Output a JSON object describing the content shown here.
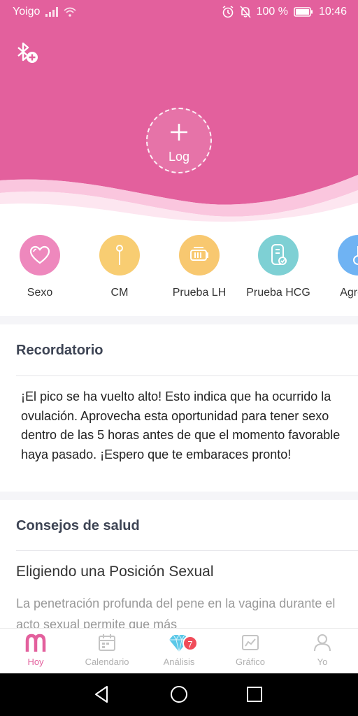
{
  "status_bar": {
    "carrier": "Yoigo",
    "battery": "100 %",
    "time": "10:46"
  },
  "header": {
    "log_label": "Log",
    "colors": {
      "primary": "#e3609d",
      "light": "#f9bcd8"
    }
  },
  "quick_actions": [
    {
      "label": "Sexo",
      "icon": "heart-icon",
      "color": "#ee88bd"
    },
    {
      "label": "CM",
      "icon": "cm-drop-icon",
      "color": "#f8cd72"
    },
    {
      "label": "Prueba LH",
      "icon": "lh-test-icon",
      "color": "#f8c870"
    },
    {
      "label": "Prueba HCG",
      "icon": "hcg-test-icon",
      "color": "#7ed0d4"
    },
    {
      "label": "Agrega",
      "icon": "add-record-icon",
      "color": "#6fb3f3"
    }
  ],
  "reminder": {
    "title": "Recordatorio",
    "text": "¡El pico se ha vuelto alto! Esto indica que ha ocurrido la ovulación. Aprovecha esta oportunidad para tener sexo dentro de las 5 horas antes de que el momento favorable haya pasado. ¡Espero que te embaraces pronto!"
  },
  "health_tips": {
    "title": "Consejos de salud",
    "article_title": "Eligiendo una Posición Sexual",
    "article_excerpt": "La penetración profunda del pene en la vagina durante el acto sexual permite que más"
  },
  "tabs": [
    {
      "label": "Hoy",
      "icon": "today-icon",
      "active": true
    },
    {
      "label": "Calendario",
      "icon": "calendar-icon",
      "active": false
    },
    {
      "label": "Análisis",
      "icon": "diamond-icon",
      "active": false,
      "badge": "7"
    },
    {
      "label": "Gráfico",
      "icon": "chart-icon",
      "active": false
    },
    {
      "label": "Yo",
      "icon": "profile-icon",
      "active": false
    }
  ]
}
